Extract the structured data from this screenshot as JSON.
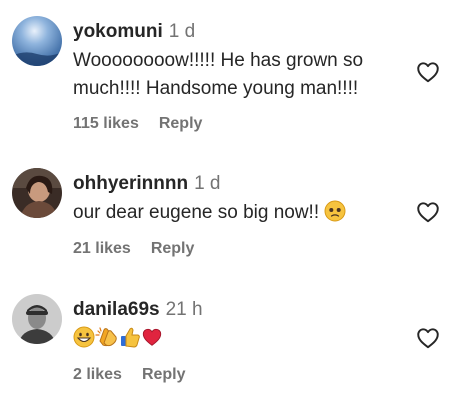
{
  "comments": [
    {
      "username": "yokomuni",
      "time": "1 d",
      "text": "Woooooooow!!!!! He has grown so much!!!! Handsome young man!!!!",
      "likes": "115 likes",
      "reply": "Reply",
      "avatar": "sky-photo"
    },
    {
      "username": "ohhyerinnnn",
      "time": "1 d",
      "text": "our dear eugene so big now!!",
      "emoji": "pleading-face",
      "likes": "21 likes",
      "reply": "Reply",
      "avatar": "person-photo"
    },
    {
      "username": "danila69s",
      "time": "21 h",
      "emojis": [
        "grinning-face",
        "clapping-hands",
        "thumbs-up",
        "red-heart"
      ],
      "likes": "2 likes",
      "reply": "Reply",
      "avatar": "bw-portrait"
    }
  ],
  "icons": {
    "like": "heart-outline-icon"
  },
  "colors": {
    "text": "#262626",
    "muted": "#737373"
  }
}
